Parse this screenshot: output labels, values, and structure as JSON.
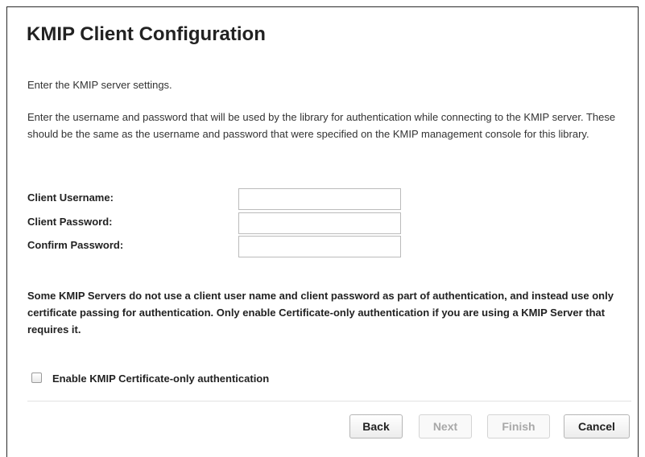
{
  "dialog": {
    "title": "KMIP Client Configuration",
    "intro": "Enter the KMIP server settings.",
    "description": "Enter the username and password that will be used by the library for authentication while connecting to the KMIP server. These should be the same as the username and password that were specified on the KMIP management console for this library."
  },
  "form": {
    "username_label": "Client Username:",
    "username_value": "",
    "password_label": "Client Password:",
    "password_value": "",
    "confirm_label": "Confirm Password:",
    "confirm_value": ""
  },
  "note": "Some KMIP Servers do not use a client user name and client password as part of authentication, and instead use only certificate passing for authentication. Only enable Certificate-only authentication if you are using a KMIP Server that requires it.",
  "certificate_only": {
    "label": "Enable KMIP Certificate-only authentication",
    "checked": false
  },
  "buttons": {
    "back": "Back",
    "next": "Next",
    "finish": "Finish",
    "cancel": "Cancel"
  }
}
